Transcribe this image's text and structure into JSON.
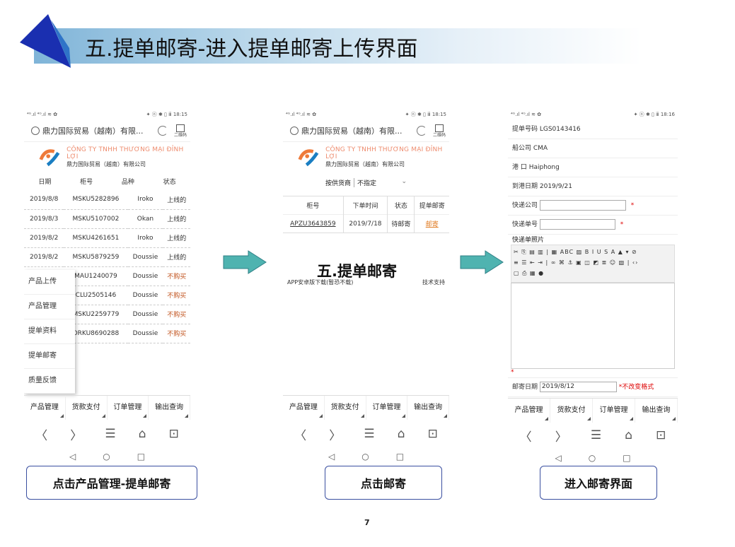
{
  "slide": {
    "title": "五.提单邮寄-进入提单邮寄上传界面",
    "page_number": "7",
    "accent": "#3a4fa0",
    "arrow_color": "#4fb3b0"
  },
  "phone_common": {
    "status_left": "⁴ᴳ.ıl ⁴ᴳ.ıl ≋ ✿",
    "status_right": "✦ ⓝ ✱ ▯ ⅲ 18:15",
    "status_right_3": "✦ ⓝ ✱ ▯ ⅲ 18:16",
    "url": "鼎力国际贸易（越南）有限...",
    "tab_label": "二维码",
    "company_vi": "CÔNG TY TNHH THƯƠNG MẠI ĐỈNH LỢI",
    "company_cn": "鼎力国际贸易（越南）有限公司",
    "bottom_tabs": [
      "产品管理",
      "货款支付",
      "订单管理",
      "输出查询"
    ],
    "nav": [
      "〈",
      "〉",
      "☰",
      "⌂",
      "⊡"
    ],
    "sysnav": [
      "◁",
      "○",
      "□"
    ]
  },
  "phone1": {
    "headers": [
      "日期",
      "柜号",
      "品种",
      "状态"
    ],
    "rows": [
      [
        "2019/8/8",
        "MSKU5282896",
        "Iroko",
        "上线的"
      ],
      [
        "2019/8/3",
        "MSKU5107002",
        "Okan",
        "上线的"
      ],
      [
        "2019/8/2",
        "MSKU4261651",
        "Iroko",
        "上线的"
      ],
      [
        "2019/8/2",
        "MSKU5879259",
        "Doussie",
        "上线的"
      ],
      [
        "",
        "MAU1240079",
        "Doussie",
        "不购买"
      ],
      [
        "",
        "CLU2505146",
        "Doussie",
        "不购买"
      ],
      [
        "",
        "MSKU2259779",
        "Doussie",
        "不购买"
      ],
      [
        "",
        "ORKU8690288",
        "Doussie",
        "不购买"
      ]
    ],
    "menu": [
      "产品上传",
      "产品管理",
      "提单资料",
      "提单邮寄",
      "质量反馈"
    ]
  },
  "phone2": {
    "filter_label": "按供货商",
    "filter_value": "不指定",
    "headers": [
      "柜号",
      "下单时间",
      "状态",
      "提单邮寄"
    ],
    "row": [
      "APZU3643859",
      "2019/7/18",
      "待邮寄",
      "邮寄"
    ],
    "overlay_title": "五.提单邮寄",
    "footer_left": "APP安卓版下载(暂恐不载)",
    "footer_right": "技术支持"
  },
  "phone3": {
    "bl_no": "提单号码 LGS0143416",
    "shipping_co": "船公司 CMA",
    "port": "港 口 Haiphong",
    "arrival": "到港日期 2019/9/21",
    "courier_label": "快递公司",
    "tracking_label": "快递单号",
    "photo_label": "快递单照片",
    "mail_date_label": "邮寄日期",
    "mail_date_value": "2019/8/12",
    "date_format_hint": "*不改变格式",
    "req_mark": "*"
  },
  "captions": [
    "点击产品管理-提单邮寄",
    "点击邮寄",
    "进入邮寄界面"
  ],
  "toolbar_rows": [
    "✂ ⎘ ▤ ▥ | ▦ ABC ▨ B I U S A ▲ ▾ ⊘",
    "≡ ☰ ⇤ ⇥ | ∞ ⌘ ⚓ ▣ ◫ ◩ ≣ ☺ ▧ | ‹›",
    "▢ ⎙ ▦ ●"
  ]
}
